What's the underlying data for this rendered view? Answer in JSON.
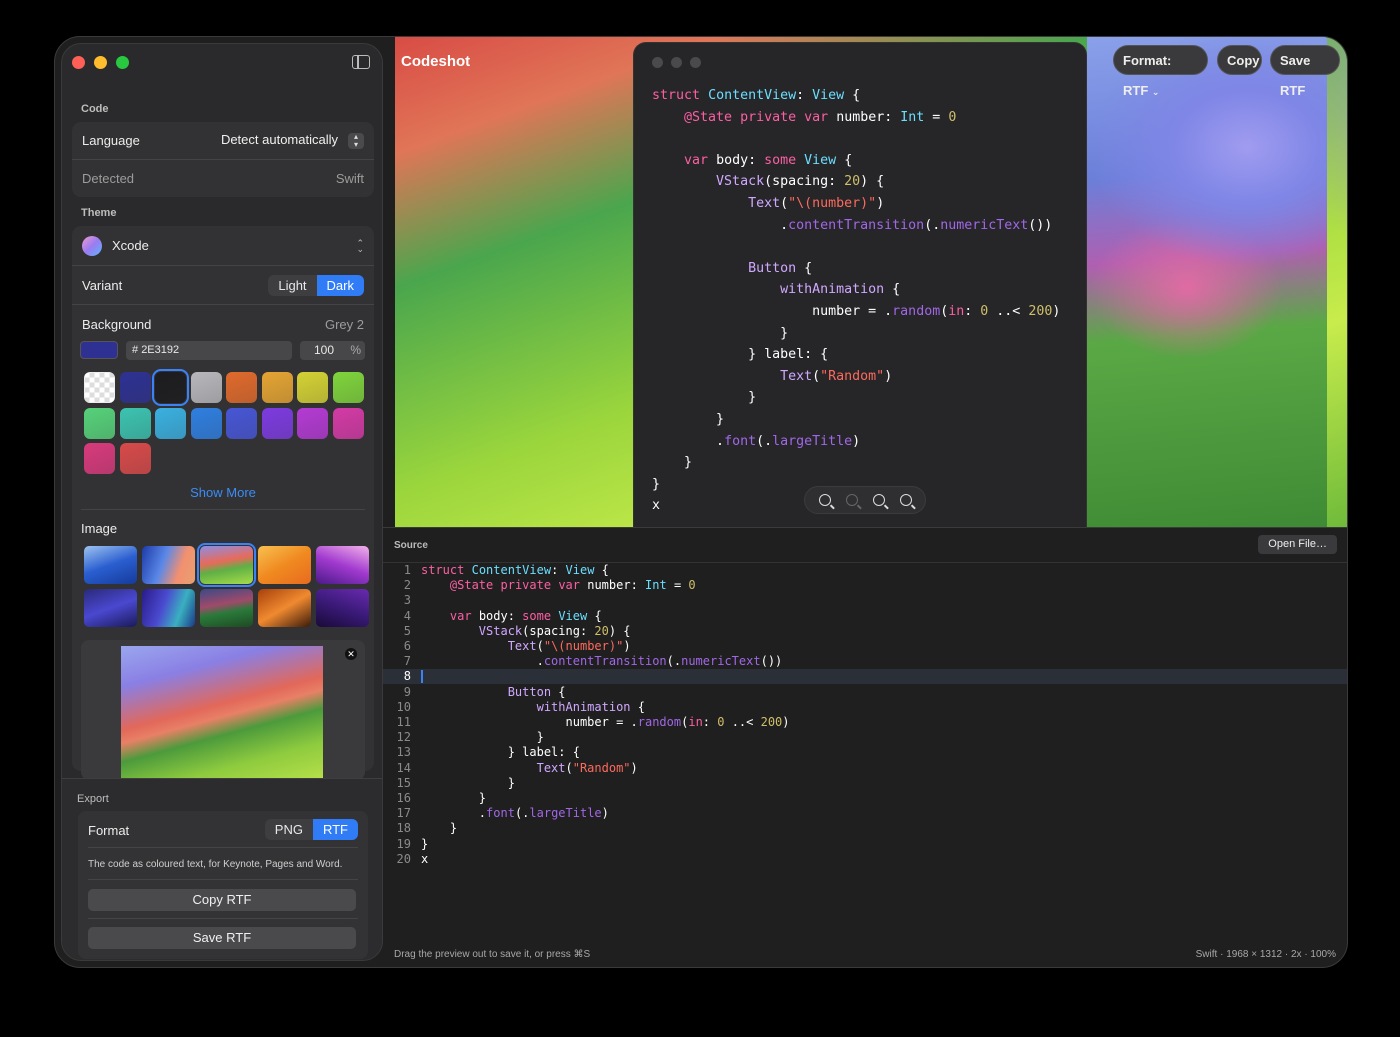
{
  "window": {
    "traffic_lights": {
      "close": "#fe5f57",
      "minimize": "#febc2e",
      "zoom": "#28c840"
    },
    "sidebar_toggle_icon": "sidebar-toggle-icon"
  },
  "sidebar": {
    "code": {
      "label": "Code",
      "language_label": "Language",
      "language_value": "Detect automatically",
      "detected_label": "Detected",
      "detected_value": "Swift"
    },
    "theme": {
      "label": "Theme",
      "name": "Xcode",
      "variant_label": "Variant",
      "variant_options": [
        "Light",
        "Dark"
      ],
      "variant_selected": "Dark",
      "background_label": "Background",
      "background_value": "Grey 2",
      "hex_value": "2E3192",
      "hex_prefix": "#",
      "opacity_value": "100",
      "opacity_unit": "%",
      "swatch_colors": [
        "transparent",
        "#2e3192",
        "#1c1c1e",
        "#b8b8bc",
        "#e06a2c",
        "#e4a433",
        "#d4d234",
        "#7fd43c",
        "#56d27a",
        "#3cc3b0",
        "#3ab0e0",
        "#2f7fe0",
        "#4756d6",
        "#7d3be0",
        "#b43ad4",
        "#d43aa6",
        "#d83a7c",
        "#d84a4a"
      ],
      "selected_swatch": 2,
      "show_more": "Show More"
    },
    "image": {
      "label": "Image",
      "selected_thumb": 2
    },
    "export": {
      "label": "Export",
      "format_label": "Format",
      "format_options": [
        "PNG",
        "RTF"
      ],
      "format_selected": "RTF",
      "description": "The code as coloured text, for Keynote, Pages and Word.",
      "copy_button": "Copy RTF",
      "save_button": "Save RTF"
    }
  },
  "toolbar": {
    "title": "Codeshot",
    "format_button": "Format: RTF",
    "copy_button": "Copy",
    "save_button": "Save RTF"
  },
  "preview": {
    "code_lines": [
      "struct ContentView: View {",
      "    @State private var number: Int = 0",
      "",
      "    var body: some View {",
      "        VStack(spacing: 20) {",
      "            Text(\"\\(number)\")",
      "                .contentTransition(.numericText())",
      "",
      "            Button {",
      "                withAnimation {",
      "                    number = .random(in: 0 ..< 200)",
      "                }",
      "            } label: {",
      "                Text(\"Random\")",
      "            }",
      "        }",
      "        .font(.largeTitle)",
      "    }",
      "}",
      "x"
    ]
  },
  "source": {
    "label": "Source",
    "open_file": "Open File…",
    "current_line": 8
  },
  "status": {
    "hint": "Drag the preview out to save it, or press ⌘S",
    "info": "Swift · 1968 × 1312 · 2x · 100%"
  }
}
